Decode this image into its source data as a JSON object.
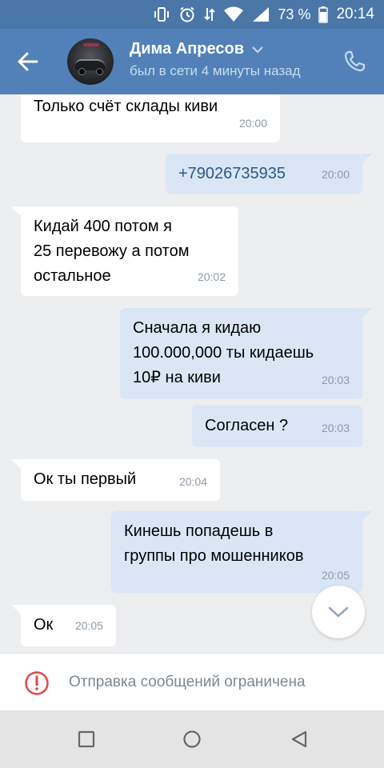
{
  "status_bar": {
    "battery_percent": "73 %",
    "time": "20:14",
    "icons": [
      "vibrate-icon",
      "alarm-icon",
      "data-transfer-icon",
      "wifi-icon",
      "signal-icon",
      "battery-icon"
    ]
  },
  "header": {
    "contact_name": "Дима Апресов",
    "contact_status": "был в сети 4 минуты назад",
    "icons": [
      "back-arrow-icon",
      "chevron-down-icon",
      "phone-icon"
    ]
  },
  "colors": {
    "header_bg": "#5181b8",
    "status_bar_bg": "#4a76a8",
    "chat_bg": "#edeef0",
    "incoming_bubble": "#ffffff",
    "outgoing_bubble": "#dae6f5",
    "warning_red": "#e64646"
  },
  "messages": [
    {
      "direction": "in",
      "text": "Только счёт склады киви",
      "time": "20:00"
    },
    {
      "direction": "out",
      "text": "+79026735935",
      "time": "20:00"
    },
    {
      "direction": "in",
      "text": "Кидай 400 потом я\n25 перевожу а потом\nостальное",
      "time": "20:02"
    },
    {
      "direction": "out",
      "text": "Сначала я кидаю\n100.000,000 ты кидаешь\n10₽ на киви",
      "time": "20:03"
    },
    {
      "direction": "out",
      "text": "Согласен ?",
      "time": "20:03"
    },
    {
      "direction": "in",
      "text": "Ок ты первый",
      "time": "20:04"
    },
    {
      "direction": "out",
      "text": "Кинешь  попадешь в\nгруппы про мошенников",
      "time": "20:05"
    },
    {
      "direction": "in",
      "text": "Ок",
      "time": "20:05"
    }
  ],
  "restriction": {
    "text": "Отправка сообщений ограничена",
    "icon": "exclamation-circle-icon"
  },
  "nav_bar": {
    "icons": [
      "recents-square-icon",
      "home-circle-icon",
      "back-triangle-icon"
    ]
  }
}
